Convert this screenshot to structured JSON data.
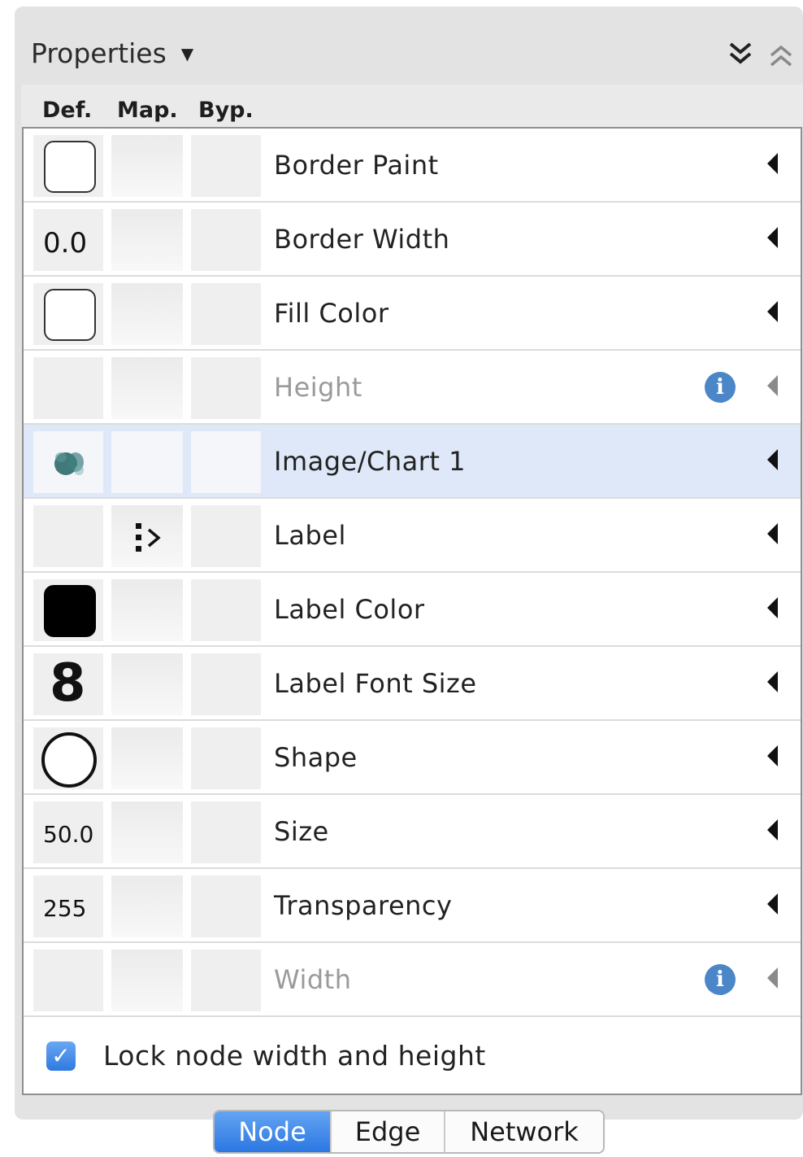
{
  "panel": {
    "title": "Properties",
    "columns": {
      "def": "Def.",
      "map": "Map.",
      "byp": "Byp."
    }
  },
  "rows": [
    {
      "label": "Border Paint",
      "def_kind": "white-swatch",
      "def_text": "",
      "disabled": false,
      "selected": false,
      "info": false
    },
    {
      "label": "Border Width",
      "def_kind": "text",
      "def_text": "0.0",
      "disabled": false,
      "selected": false,
      "info": false
    },
    {
      "label": "Fill Color",
      "def_kind": "white-swatch",
      "def_text": "",
      "disabled": false,
      "selected": false,
      "info": false
    },
    {
      "label": "Height",
      "def_kind": "none",
      "def_text": "",
      "disabled": true,
      "selected": false,
      "info": true
    },
    {
      "label": "Image/Chart 1",
      "def_kind": "image-blob",
      "def_text": "",
      "disabled": false,
      "selected": true,
      "info": false
    },
    {
      "label": "Label",
      "def_kind": "none",
      "def_text": "",
      "disabled": false,
      "selected": false,
      "info": false,
      "mapped": true
    },
    {
      "label": "Label Color",
      "def_kind": "black-swatch",
      "def_text": "",
      "disabled": false,
      "selected": false,
      "info": false
    },
    {
      "label": "Label Font Size",
      "def_kind": "big-text",
      "def_text": "8",
      "disabled": false,
      "selected": false,
      "info": false
    },
    {
      "label": "Shape",
      "def_kind": "circle",
      "def_text": "",
      "disabled": false,
      "selected": false,
      "info": false
    },
    {
      "label": "Size",
      "def_kind": "small-text",
      "def_text": "50.0",
      "disabled": false,
      "selected": false,
      "info": false
    },
    {
      "label": "Transparency",
      "def_kind": "small-text",
      "def_text": "255",
      "disabled": false,
      "selected": false,
      "info": false
    },
    {
      "label": "Width",
      "def_kind": "none",
      "def_text": "",
      "disabled": true,
      "selected": false,
      "info": true
    }
  ],
  "lock": {
    "label": "Lock node width and height",
    "checked": true
  },
  "tabs": [
    {
      "label": "Node",
      "active": true
    },
    {
      "label": "Edge",
      "active": false
    },
    {
      "label": "Network",
      "active": false
    }
  ],
  "colors": {
    "accent": "#2b77e2",
    "selected_row": "#dfe8f8",
    "info": "#4a86c8"
  }
}
